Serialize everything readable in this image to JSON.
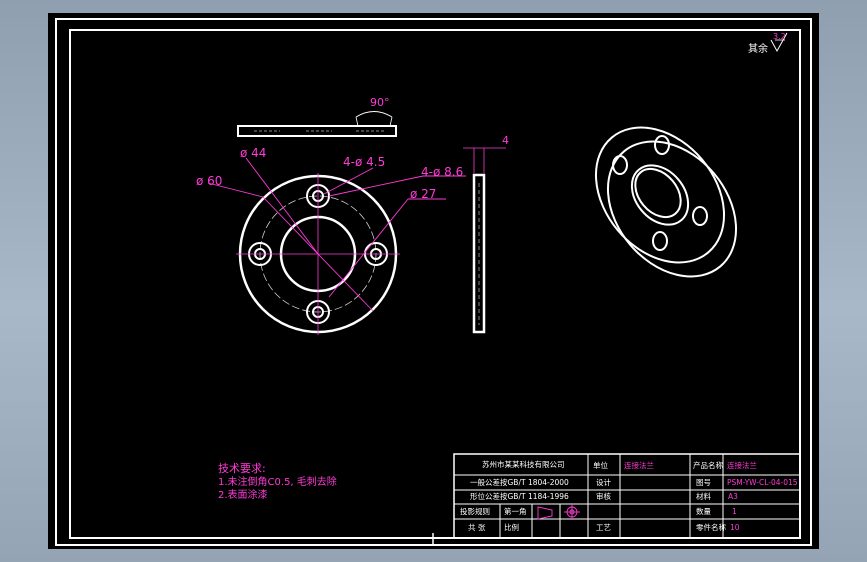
{
  "drawing": {
    "roughness_symbol": "其余",
    "roughness_value": "3.2",
    "angle_dimension": "90°",
    "thickness_dimension": "4",
    "dimensions": {
      "outer_diameter": "ø 60",
      "bolt_circle": "ø 44",
      "small_holes": "4-ø 4.5",
      "counterbore_holes": "4-ø 8.6",
      "inner_diameter": "ø 27"
    }
  },
  "technical_requirements": {
    "title": "技术要求:",
    "items": [
      "1.未注倒角C0.5, 毛刺去除",
      "2.表面涂漆"
    ]
  },
  "title_block": {
    "company": "苏州市某某科技有限公司",
    "tolerance_note_1": "一般公差按GB/T 1804-2000",
    "tolerance_note_2": "形位公差按GB/T 1184-1996",
    "projection_label": "投影规则",
    "projection_value": "第一角",
    "scale_cell": "共  张",
    "scale_label": "比例",
    "part_name_label": "零件名称",
    "part_name_value": "连接法兰",
    "material_label": "材料",
    "material_value": "A3",
    "quantity_label": "数量",
    "quantity_value": "1",
    "drawing_no_label": "图号",
    "drawing_no_value": "PSM-YW-CL-04-015",
    "process_label": "工艺",
    "process_value": "10",
    "design_label": "设计",
    "check_label": "审核",
    "unit_label": "单位",
    "product_label": "产品名称",
    "product_value": "连接法兰"
  }
}
